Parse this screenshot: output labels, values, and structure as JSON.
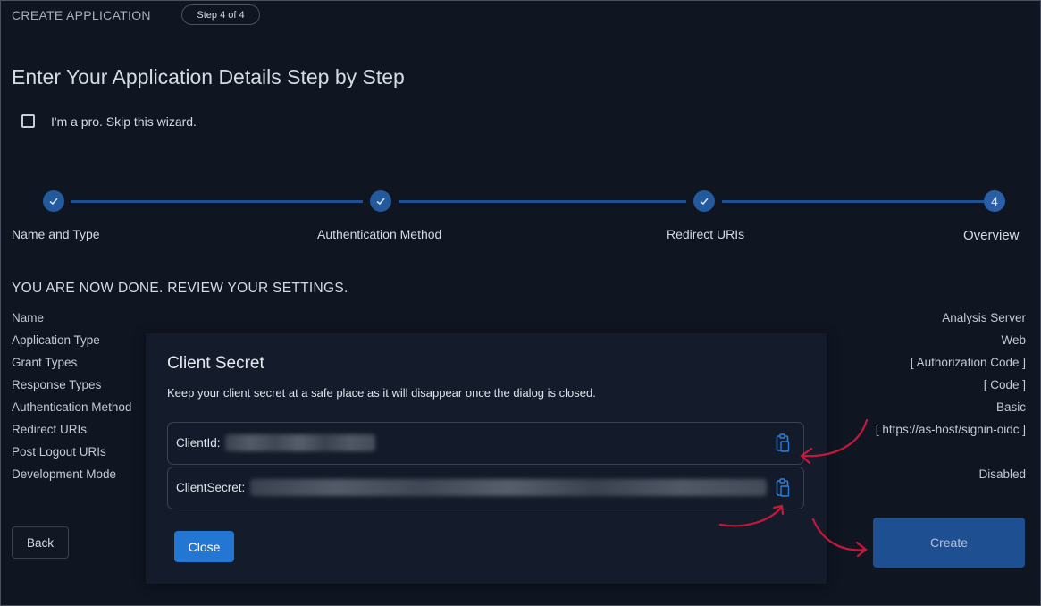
{
  "header": {
    "title": "CREATE APPLICATION",
    "step_badge": "Step 4 of 4"
  },
  "page_title": "Enter Your Application Details Step by Step",
  "skip_wizard_label": "I'm a pro. Skip this wizard.",
  "stepper": {
    "steps": [
      {
        "label": "Name and Type",
        "state": "done"
      },
      {
        "label": "Authentication Method",
        "state": "done"
      },
      {
        "label": "Redirect URIs",
        "state": "done"
      },
      {
        "label": "Overview",
        "state": "current",
        "number": "4"
      }
    ]
  },
  "review": {
    "heading": "YOU ARE NOW DONE. REVIEW YOUR SETTINGS.",
    "rows": [
      {
        "label": "Name",
        "value": "Analysis Server"
      },
      {
        "label": "Application Type",
        "value": "Web"
      },
      {
        "label": "Grant Types",
        "value": "[ Authorization Code ]"
      },
      {
        "label": "Response Types",
        "value": "[ Code ]"
      },
      {
        "label": "Authentication Method",
        "value": "Basic"
      },
      {
        "label": "Redirect URIs",
        "value": "[ https://as-host/signin-oidc ]"
      },
      {
        "label": "Post Logout URIs",
        "value": ""
      },
      {
        "label": "Development Mode",
        "value": "Disabled"
      }
    ]
  },
  "buttons": {
    "back": "Back",
    "create": "Create"
  },
  "dialog": {
    "title": "Client Secret",
    "description": "Keep your client secret at a safe place as it will disappear once the dialog is closed.",
    "client_id_label": "ClientId:",
    "client_secret_label": "ClientSecret:",
    "close_label": "Close"
  },
  "colors": {
    "background": "#0f1521",
    "accent": "#2377d3",
    "step_done": "#235a9e",
    "annotation_arrow": "#c8183a"
  },
  "icons": {
    "step_done": "check-icon",
    "copy": "clipboard-copy-icon"
  }
}
